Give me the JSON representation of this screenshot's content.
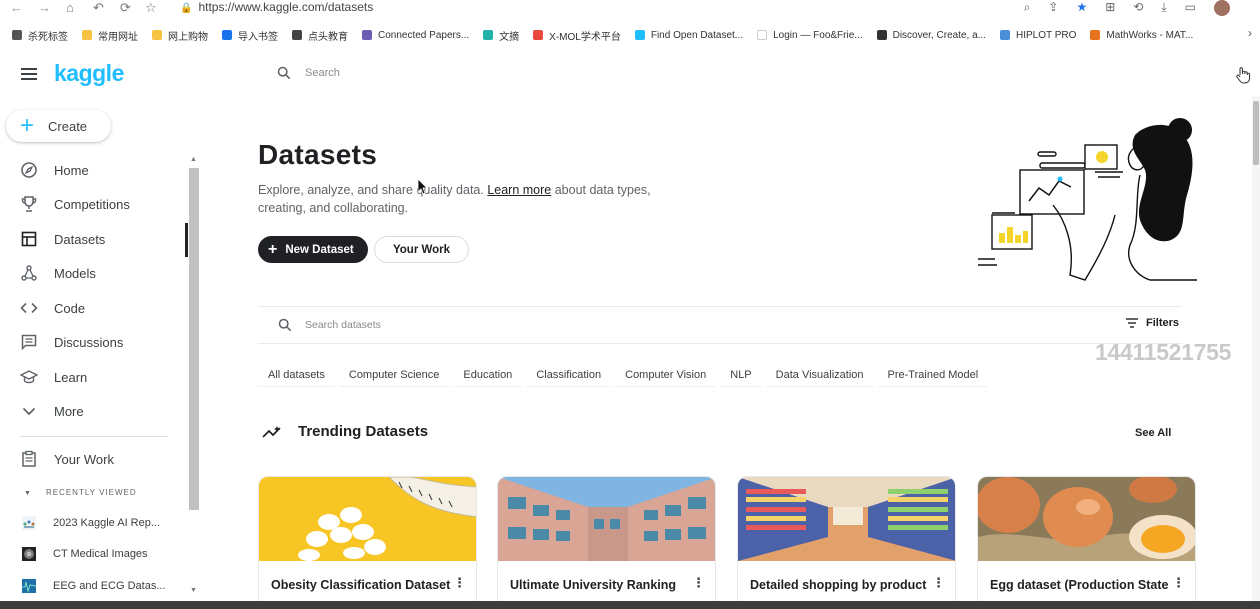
{
  "browser": {
    "url": "https://www.kaggle.com/datasets",
    "bookmarks": [
      {
        "label": "杀死标签",
        "color": "#555555"
      },
      {
        "label": "常用网址",
        "color": "#f6c343"
      },
      {
        "label": "网上购物",
        "color": "#f6c343"
      },
      {
        "label": "导入书签",
        "color": "#1a73e8"
      },
      {
        "label": "点头教育",
        "color": "#444444"
      },
      {
        "label": "Connected Papers...",
        "color": "#6b5fb5"
      },
      {
        "label": "文摘",
        "color": "#20b2aa"
      },
      {
        "label": "X-MOL学术平台",
        "color": "#e8473c"
      },
      {
        "label": "Find Open Dataset...",
        "color": "#20beff"
      },
      {
        "label": "Login — Foo&Frie...",
        "color": "#ffffff"
      },
      {
        "label": "Discover, Create, a...",
        "color": "#333333"
      },
      {
        "label": "HIPLOT PRO",
        "color": "#4a90d9"
      },
      {
        "label": "MathWorks - MAT...",
        "color": "#e8731c"
      }
    ]
  },
  "header": {
    "logo": "kaggle",
    "search_placeholder": "Search"
  },
  "sidebar": {
    "create_label": "Create",
    "items": [
      {
        "label": "Home",
        "icon": "compass-icon"
      },
      {
        "label": "Competitions",
        "icon": "trophy-icon"
      },
      {
        "label": "Datasets",
        "icon": "table-icon"
      },
      {
        "label": "Models",
        "icon": "models-icon"
      },
      {
        "label": "Code",
        "icon": "code-icon"
      },
      {
        "label": "Discussions",
        "icon": "discussion-icon"
      },
      {
        "label": "Learn",
        "icon": "graduation-cap-icon"
      },
      {
        "label": "More",
        "icon": "chevron-down-icon"
      }
    ],
    "your_work": "Your Work",
    "recently_viewed_label": "RECENTLY VIEWED",
    "recent": [
      {
        "label": "2023 Kaggle AI Rep..."
      },
      {
        "label": "CT Medical Images"
      },
      {
        "label": "EEG and ECG Datas..."
      }
    ]
  },
  "main": {
    "title": "Datasets",
    "desc_before": "Explore, analyze, and share quality data. ",
    "desc_link": "Learn more",
    "desc_after": " about data types, creating, and collaborating.",
    "new_dataset_label": "New Dataset",
    "your_work_label": "Your Work",
    "search_placeholder": "Search datasets",
    "filters_label": "Filters",
    "watermark": "14411521755",
    "chips": [
      "All datasets",
      "Computer Science",
      "Education",
      "Classification",
      "Computer Vision",
      "NLP",
      "Data Visualization",
      "Pre-Trained Model"
    ],
    "trending_title": "Trending Datasets",
    "see_all": "See All",
    "cards": [
      {
        "title": "Obesity Classification Dataset"
      },
      {
        "title": "Ultimate University Ranking"
      },
      {
        "title": "Detailed shopping by product"
      },
      {
        "title": "Egg dataset (Production State"
      }
    ]
  },
  "colors": {
    "brand": "#20beff",
    "primary_button": "#202124"
  }
}
